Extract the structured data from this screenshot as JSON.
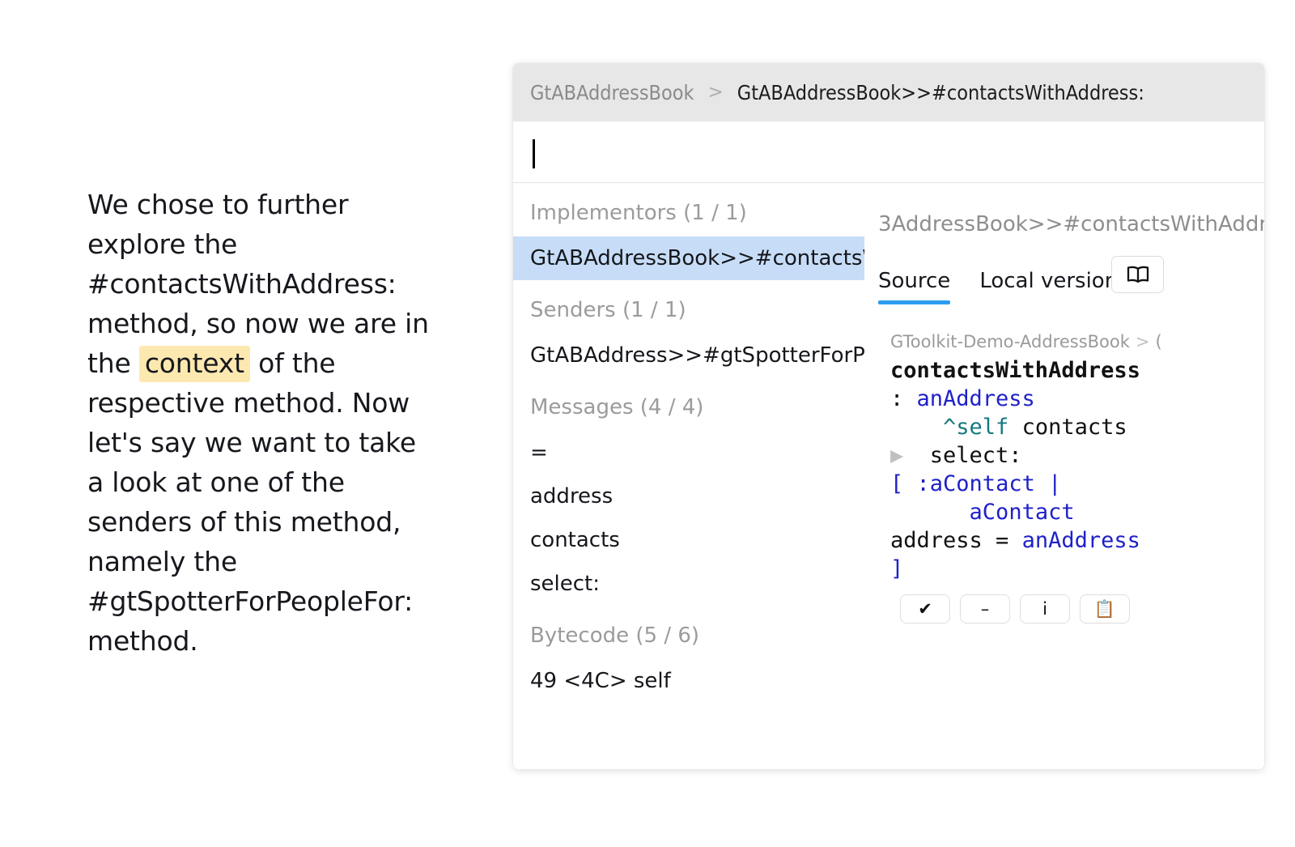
{
  "narrative": {
    "part1": "We chose to further explore the #contactsWithAddress: method, so now we are in the ",
    "highlight": "context",
    "part2": " of the respective method. Now let's say we want to take a look at one of the senders of this method, namely the #gtSpotterForPeopleFor: method."
  },
  "card": {
    "breadcrumb": {
      "root": "GtABAddressBook",
      "separator": ">",
      "current": "GtABAddressBook>>#contactsWithAddress:"
    },
    "search": {
      "value": "",
      "placeholder": ""
    },
    "results": {
      "groups": [
        {
          "title": "Implementors (1 / 1)",
          "items": [
            {
              "label": "GtABAddressBook>>#contactsWithAddress:",
              "selected": true
            }
          ]
        },
        {
          "title": "Senders (1 / 1)",
          "items": [
            {
              "label": "GtABAddress>>#gtSpotterForPeopleFor:",
              "selected": false
            }
          ]
        },
        {
          "title": "Messages (4 / 4)",
          "items": [
            {
              "label": "=",
              "selected": false
            },
            {
              "label": "address",
              "selected": false
            },
            {
              "label": "contacts",
              "selected": false
            },
            {
              "label": "select:",
              "selected": false
            }
          ]
        },
        {
          "title": "Bytecode (5 / 6)",
          "items": [
            {
              "label": "49 <4C> self",
              "selected": false
            }
          ]
        }
      ]
    },
    "detail": {
      "title": "3AddressBook>>#contactsWithAddr",
      "tabs": [
        {
          "label": "Source",
          "active": true
        },
        {
          "label": "Local versions",
          "active": false
        }
      ],
      "book_button_icon": "open-book-icon",
      "code_breadcrumb": {
        "package": "GToolkit-Demo-AddressBook",
        "separator": ">",
        "next": "("
      },
      "code_lines": [
        {
          "tri": false,
          "tokens": [
            {
              "t": "contactsWithAddress",
              "c": "sel"
            }
          ]
        },
        {
          "tri": false,
          "tokens": [
            {
              "t": ": ",
              "c": ""
            },
            {
              "t": "anAddress",
              "c": "arg"
            }
          ]
        },
        {
          "tri": false,
          "tokens": [
            {
              "t": "    ",
              "c": ""
            },
            {
              "t": "^self",
              "c": "kw"
            },
            {
              "t": " contacts",
              "c": ""
            }
          ]
        },
        {
          "tri": true,
          "tokens": [
            {
              "t": " select:",
              "c": ""
            }
          ]
        },
        {
          "tri": false,
          "tokens": [
            {
              "t": "[",
              "c": "punct"
            },
            {
              "t": " ",
              "c": ""
            },
            {
              "t": ":aContact",
              "c": "arg"
            },
            {
              "t": " ",
              "c": ""
            },
            {
              "t": "|",
              "c": "punct"
            }
          ]
        },
        {
          "tri": false,
          "tokens": [
            {
              "t": "      ",
              "c": ""
            },
            {
              "t": "aContact",
              "c": "arg"
            }
          ]
        },
        {
          "tri": false,
          "tokens": [
            {
              "t": "address = ",
              "c": ""
            },
            {
              "t": "anAddress",
              "c": "arg"
            }
          ]
        },
        {
          "tri": false,
          "tokens": [
            {
              "t": "]",
              "c": "punct"
            }
          ]
        }
      ],
      "actions": [
        {
          "name": "accept-button",
          "glyph": "✔"
        },
        {
          "name": "remove-button",
          "glyph": "–"
        },
        {
          "name": "info-button",
          "glyph": "i"
        },
        {
          "name": "clipboard-button",
          "glyph": "📋"
        }
      ]
    }
  },
  "colors": {
    "selection": "#c7ddf7",
    "highlight": "#fde9b0",
    "tab_accent": "#2d9cf0",
    "header_bar": "#e7e7e7"
  }
}
